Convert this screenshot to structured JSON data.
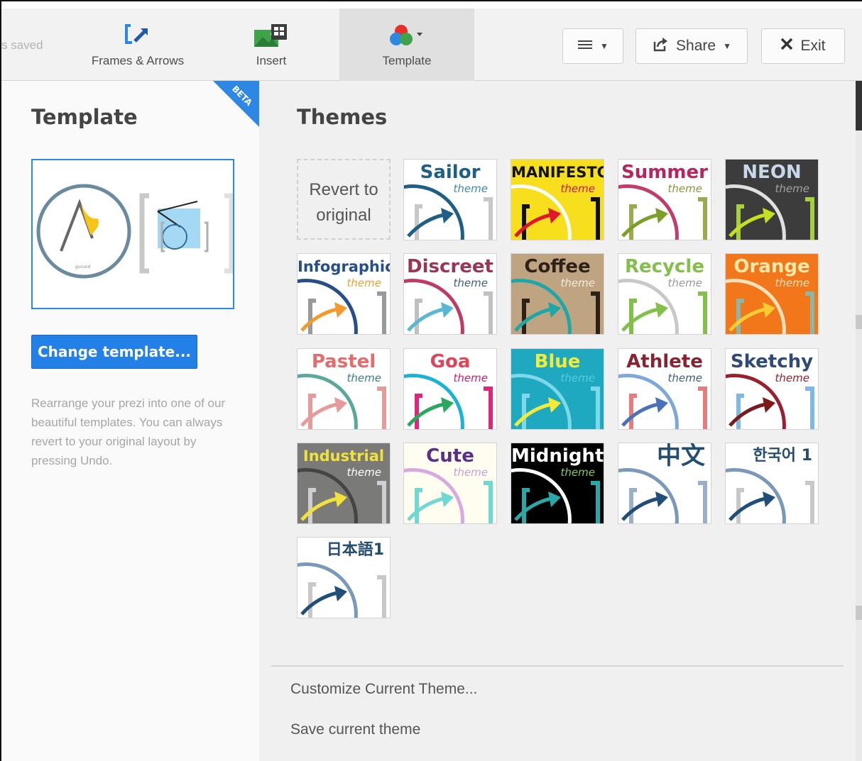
{
  "toolbar": {
    "saved_text": "s saved",
    "frames_label": "Frames & Arrows",
    "insert_label": "Insert",
    "template_label": "Template",
    "menu_icon": "hamburger-icon",
    "share_label": "Share",
    "exit_label": "Exit"
  },
  "left": {
    "title": "Template",
    "beta": "BETA",
    "change_button": "Change template...",
    "description": "Rearrange your prezi into one of our beautiful templates. You can always revert to your original layout by pressing Undo."
  },
  "right": {
    "title": "Themes",
    "revert_line1": "Revert to",
    "revert_line2": "original",
    "customize": "Customize Current Theme...",
    "save": "Save current theme"
  },
  "themes": [
    {
      "name": "Sailor",
      "sub": "theme",
      "bg": "#ffffff",
      "title_color": "#1f5f86",
      "sub_color": "#3d8ab3",
      "arc": "#1f5f86",
      "arrow": "#1f5f86",
      "bracket": "#c8c8c8"
    },
    {
      "name": "MANIFESTO",
      "sub": "theme",
      "bg": "#f7df1e",
      "title_color": "#111111",
      "sub_color": "#e0162b",
      "arc": "#ffffff",
      "arrow": "#e0162b",
      "bracket": "#111111"
    },
    {
      "name": "Summer",
      "sub": "theme",
      "bg": "#ffffff",
      "title_color": "#b7245f",
      "sub_color": "#8a9a3a",
      "arc": "#c43b6e",
      "arrow": "#7e9e2c",
      "bracket": "#9aaa4e"
    },
    {
      "name": "NEON",
      "sub": "theme",
      "bg": "#3c3c3c",
      "title_color": "#c8d8e8",
      "sub_color": "#a0a0a0",
      "arc": "#e0e0e0",
      "arrow": "#c6e020",
      "bracket": "#a5d23a"
    },
    {
      "name": "Infographic",
      "sub": "theme",
      "bg": "#ffffff",
      "title_color": "#264f8a",
      "sub_color": "#f2a031",
      "arc": "#264f8a",
      "arrow": "#f29a2e",
      "bracket": "#9a9a9a"
    },
    {
      "name": "Discreet",
      "sub": "theme",
      "bg": "#ffffff",
      "title_color": "#9a3554",
      "sub_color": "#3d5e84",
      "arc": "#c03a66",
      "arrow": "#5ab7d4",
      "bracket": "#c0c0c0"
    },
    {
      "name": "Coffee",
      "sub": "theme",
      "bg": "#bfa481",
      "title_color": "#2f2116",
      "sub_color": "#f4ead8",
      "arc": "#1ea6a8",
      "arrow": "#1ea6a8",
      "bracket": "#2f2116"
    },
    {
      "name": "Recycle",
      "sub": "theme",
      "bg": "#ffffff",
      "title_color": "#82c04a",
      "sub_color": "#9a9a9a",
      "arc": "#c8c8c8",
      "arrow": "#82c04a",
      "bracket": "#82c04a"
    },
    {
      "name": "Orange",
      "sub": "theme",
      "bg": "#f2771b",
      "title_color": "#ffe8a8",
      "sub_color": "#ffe0b8",
      "arc": "#ffe0b8",
      "arrow": "#ffcc33",
      "bracket": "#8ab8a8"
    },
    {
      "name": "Pastel",
      "sub": "theme",
      "bg": "#ffffff",
      "title_color": "#e46c6c",
      "sub_color": "#3d7c8a",
      "arc": "#5aa89a",
      "arrow": "#e79a9a",
      "bracket": "#e79a9a"
    },
    {
      "name": "Goa",
      "sub": "theme",
      "bg": "#ffffff",
      "title_color": "#e0445a",
      "sub_color": "#d01f6e",
      "arc": "#19b3d6",
      "arrow": "#2aa85e",
      "bracket": "#e0267a"
    },
    {
      "name": "Blue",
      "sub": "theme",
      "bg": "#1fa9c0",
      "title_color": "#f4ea3a",
      "sub_color": "#52cde0",
      "arc": "#7ed8e8",
      "arrow": "#f4ea3a",
      "bracket": "#7ed8e8"
    },
    {
      "name": "Athlete",
      "sub": "theme",
      "bg": "#ffffff",
      "title_color": "#8a2331",
      "sub_color": "#3d5e84",
      "arc": "#7ea8da",
      "arrow": "#4a72b8",
      "bracket": "#e87c7c"
    },
    {
      "name": "Sketchy",
      "sub": "theme",
      "bg": "#ffffff",
      "title_color": "#2f4a78",
      "sub_color": "#9a1f2f",
      "arc": "#9a1f2f",
      "arrow": "#7a1a1a",
      "bracket": "#7eb8e8"
    },
    {
      "name": "Industrial",
      "sub": "theme",
      "bg": "#7a7a78",
      "title_color": "#f0e23a",
      "sub_color": "#ffffff",
      "arc": "#444444",
      "arrow": "#f0e23a",
      "bracket": "#cfcfcf"
    },
    {
      "name": "Cute",
      "sub": "theme",
      "bg": "#fffcf0",
      "title_color": "#5a2f8a",
      "sub_color": "#c8a0d8",
      "arc": "#d8a8e0",
      "arrow": "#6fd8d0",
      "bracket": "#6fd8d0"
    },
    {
      "name": "Midnight",
      "sub": "theme",
      "bg": "#000000",
      "title_color": "#ffffff",
      "sub_color": "#8ac84a",
      "arc": "#ffffff",
      "arrow": "#2aa8a8",
      "bracket": "#2aa8a8"
    },
    {
      "name": "中文",
      "sub": "",
      "bg": "#ffffff",
      "title_color": "#244d72",
      "sub_color": "#244d72",
      "arc": "#7a98b8",
      "arrow": "#1f4f78",
      "bracket": "#9ab0c8"
    },
    {
      "name": "한국어 1",
      "sub": "",
      "bg": "#ffffff",
      "title_color": "#244d72",
      "sub_color": "#244d72",
      "arc": "#7a98b8",
      "arrow": "#1f4f78",
      "bracket": "#c8c8c8"
    },
    {
      "name": "日本語1",
      "sub": "",
      "bg": "#ffffff",
      "title_color": "#244d72",
      "sub_color": "#244d72",
      "arc": "#7a98b8",
      "arrow": "#1f4f78",
      "bracket": "#c8c8c8"
    }
  ]
}
